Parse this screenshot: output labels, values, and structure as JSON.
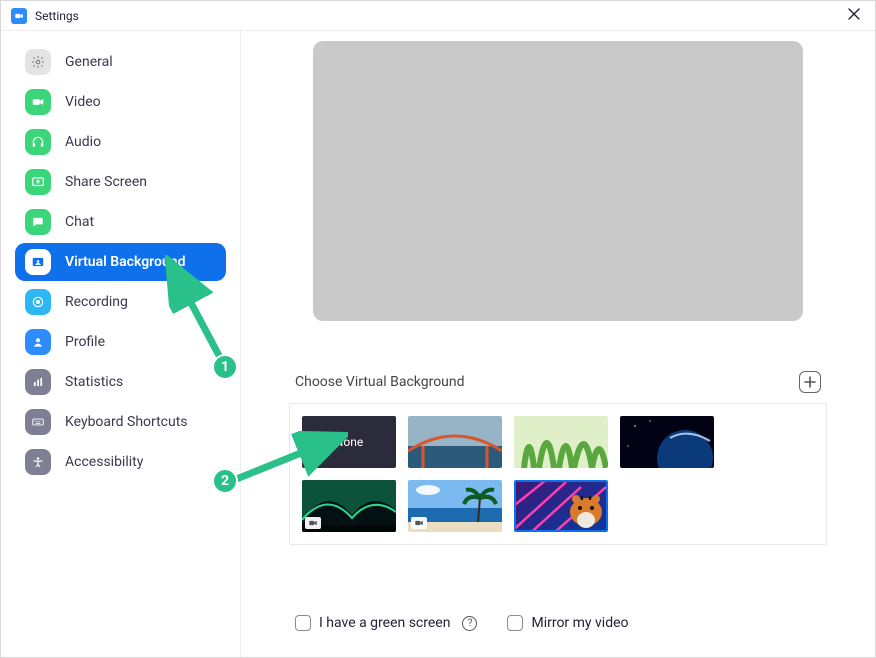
{
  "titlebar": {
    "title": "Settings"
  },
  "sidebar": {
    "items": [
      {
        "id": "general",
        "label": "General",
        "icon_color": "#e4e4e4",
        "icon_fg": "#808080"
      },
      {
        "id": "video",
        "label": "Video",
        "icon_color": "#3ad67a",
        "icon_fg": "#ffffff"
      },
      {
        "id": "audio",
        "label": "Audio",
        "icon_color": "#3ad67a",
        "icon_fg": "#ffffff"
      },
      {
        "id": "share",
        "label": "Share Screen",
        "icon_color": "#3ad67a",
        "icon_fg": "#ffffff"
      },
      {
        "id": "chat",
        "label": "Chat",
        "icon_color": "#3ad67a",
        "icon_fg": "#ffffff"
      },
      {
        "id": "vbg",
        "label": "Virtual Background",
        "icon_color": "#ffffff",
        "icon_fg": "#0E71EB",
        "selected": true
      },
      {
        "id": "recording",
        "label": "Recording",
        "icon_color": "#2db7f5",
        "icon_fg": "#ffffff"
      },
      {
        "id": "profile",
        "label": "Profile",
        "icon_color": "#2D8CFF",
        "icon_fg": "#ffffff"
      },
      {
        "id": "stats",
        "label": "Statistics",
        "icon_color": "#7e7e95",
        "icon_fg": "#ffffff"
      },
      {
        "id": "shortcuts",
        "label": "Keyboard Shortcuts",
        "icon_color": "#7e7e95",
        "icon_fg": "#ffffff"
      },
      {
        "id": "a11y",
        "label": "Accessibility",
        "icon_color": "#7e7e95",
        "icon_fg": "#ffffff"
      }
    ]
  },
  "main": {
    "choose_label": "Choose Virtual Background",
    "thumbs": {
      "none_label": "None",
      "list": [
        {
          "id": "none",
          "kind": "none"
        },
        {
          "id": "bridge",
          "kind": "image"
        },
        {
          "id": "grass",
          "kind": "image"
        },
        {
          "id": "earth",
          "kind": "image"
        },
        {
          "id": "aurora",
          "kind": "video"
        },
        {
          "id": "beach",
          "kind": "video"
        },
        {
          "id": "tiger",
          "kind": "image",
          "selected": true
        }
      ]
    },
    "green_screen_label": "I have a green screen",
    "mirror_label": "Mirror my video"
  },
  "annotations": {
    "badge1": "1",
    "badge2": "2"
  }
}
